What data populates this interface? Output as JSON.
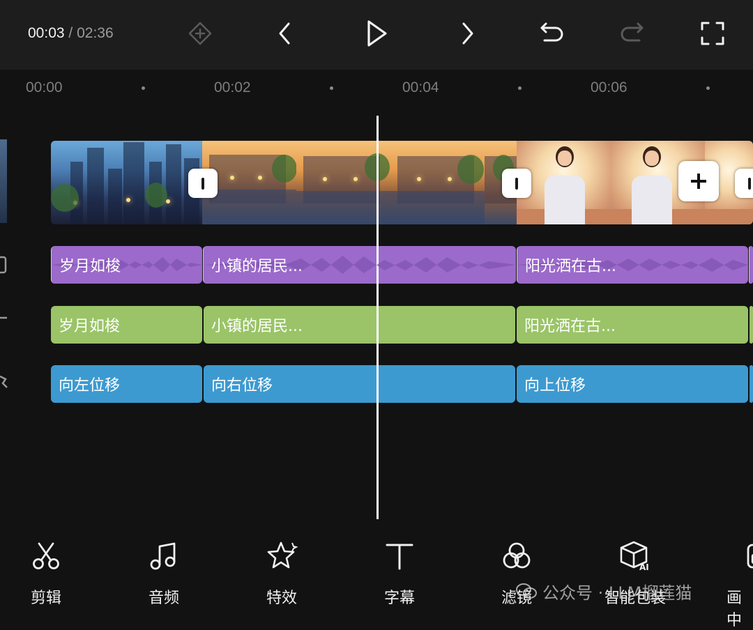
{
  "topbar": {
    "current_time": "00:03",
    "separator": "/",
    "total_time": "02:36",
    "icons": [
      "keyframe-add-icon",
      "prev-frame-icon",
      "play-icon",
      "next-frame-icon",
      "undo-icon",
      "redo-icon",
      "fullscreen-icon"
    ]
  },
  "ruler": {
    "ticks": [
      "00:00",
      "00:02",
      "00:04",
      "00:06"
    ]
  },
  "tracks": {
    "audio": [
      "岁月如梭",
      "小镇的居民...",
      "阳光洒在古..."
    ],
    "text": [
      "岁月如梭",
      "小镇的居民...",
      "阳光洒在古..."
    ],
    "effects": [
      "向左位移",
      "向右位移",
      "向上位移"
    ]
  },
  "colors": {
    "audio_track": "#9b6acb",
    "text_track": "#9ac467",
    "effect_track": "#3d9ad0",
    "background": "#121212"
  },
  "toolbar": {
    "items": [
      {
        "label": "剪辑",
        "icon": "scissors-icon"
      },
      {
        "label": "音频",
        "icon": "music-note-icon"
      },
      {
        "label": "特效",
        "icon": "sparkle-star-icon"
      },
      {
        "label": "字幕",
        "icon": "text-t-icon"
      },
      {
        "label": "滤镜",
        "icon": "filter-circles-icon"
      },
      {
        "label": "智能包装",
        "icon": "ai-box-icon"
      },
      {
        "label": "画中",
        "icon": "picture-in-picture-icon"
      }
    ]
  },
  "watermark": {
    "text": "公众号 · LLM榴莲猫"
  }
}
